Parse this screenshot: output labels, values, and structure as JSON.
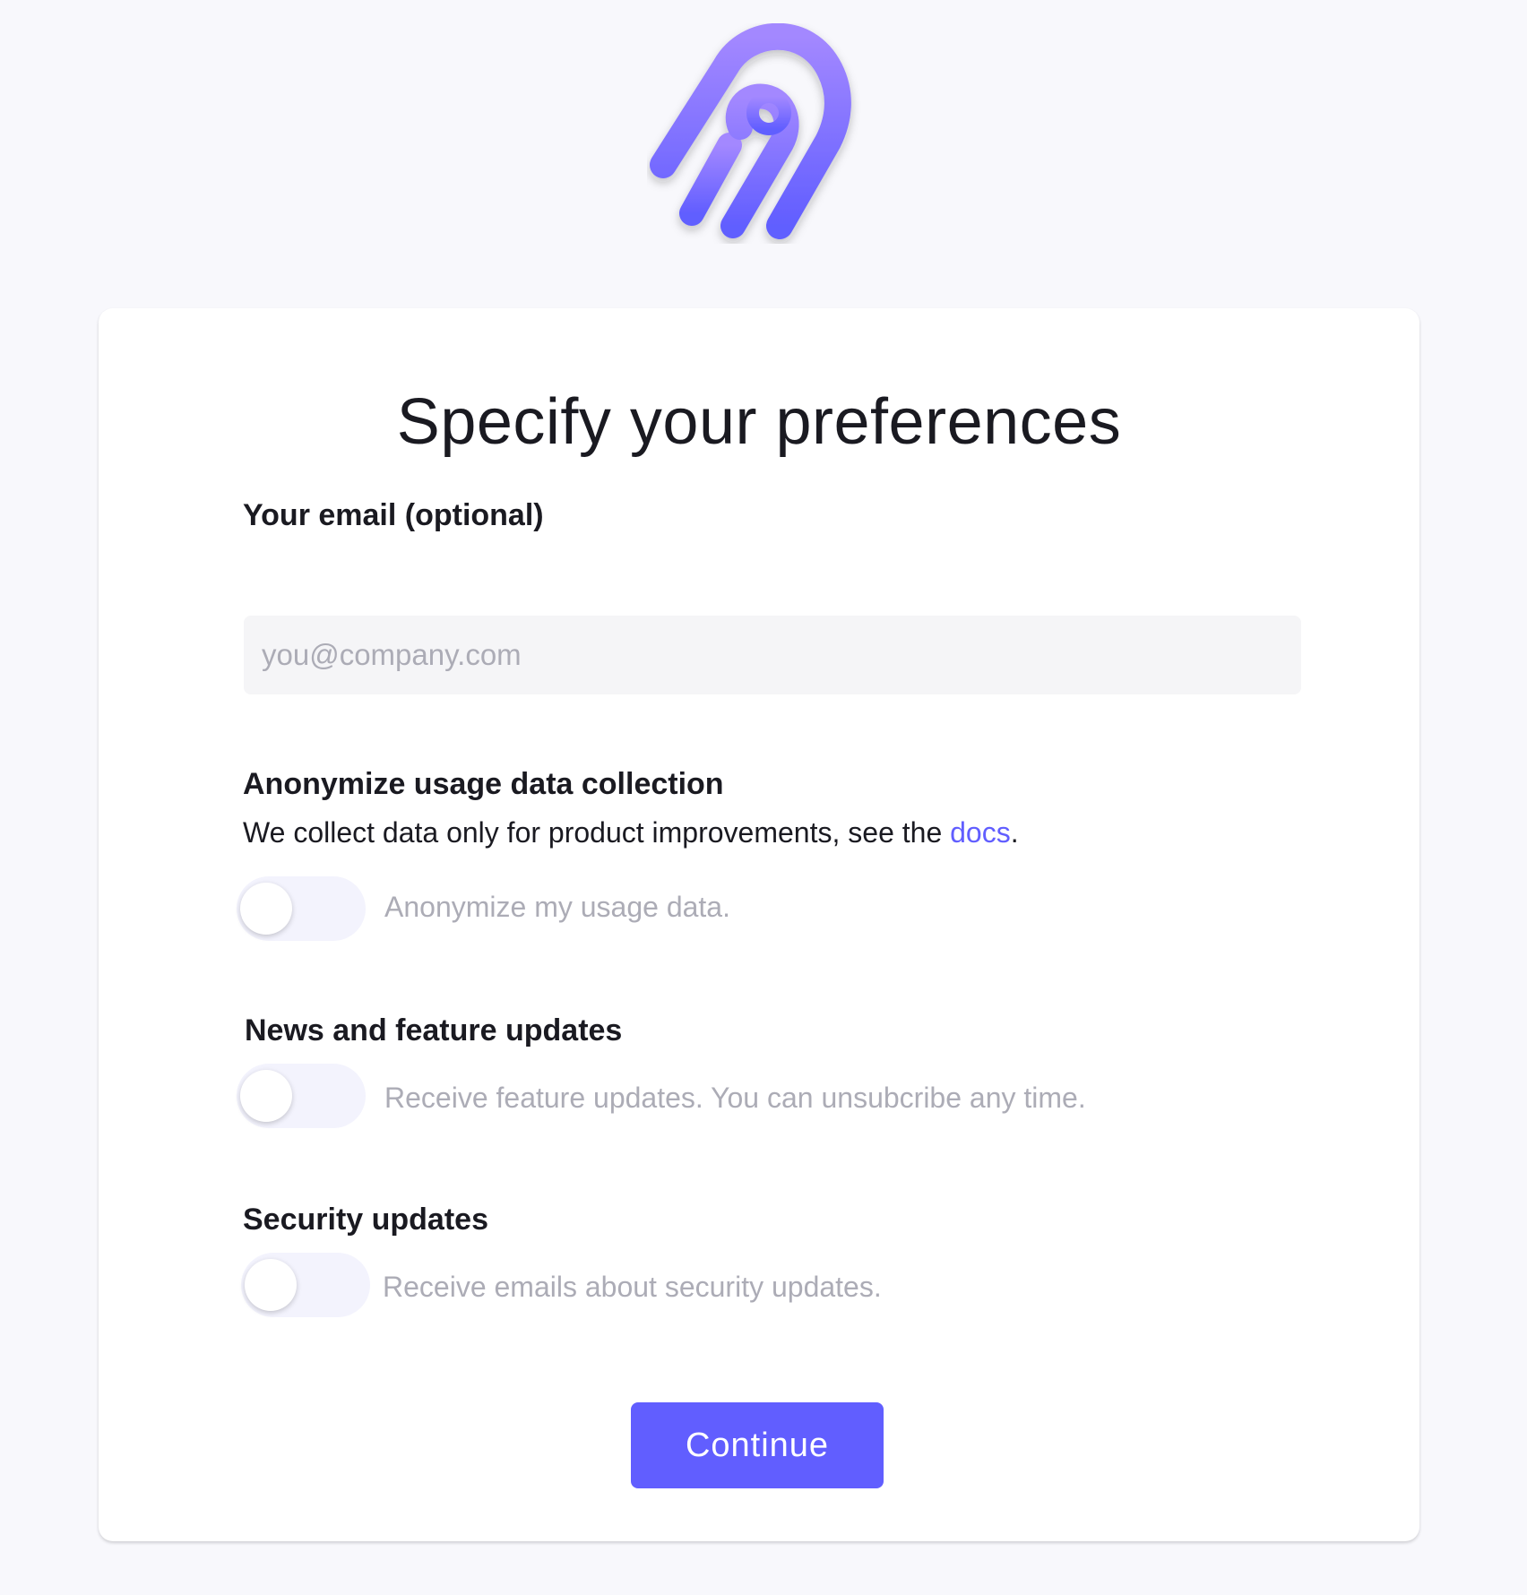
{
  "page": {
    "title": "Specify your preferences"
  },
  "email": {
    "label": "Your email (optional)",
    "placeholder": "you@company.com",
    "value": ""
  },
  "anonymize": {
    "heading": "Anonymize usage data collection",
    "description_prefix": "We collect data only for product improvements, see the ",
    "docs_link": "docs",
    "description_suffix": ".",
    "toggle_label": "Anonymize my usage data.",
    "enabled": false
  },
  "news": {
    "heading": "News and feature updates",
    "toggle_label": "Receive feature updates. You can unsubcribe any time.",
    "enabled": false
  },
  "security": {
    "heading": "Security updates",
    "toggle_label": "Receive emails about security updates.",
    "enabled": false
  },
  "actions": {
    "continue_label": "Continue"
  },
  "colors": {
    "page_background": "#f8f8fc",
    "card_background": "#ffffff",
    "primary": "#615eff",
    "text": "#1a1a21",
    "muted_text": "#acacb6",
    "input_background": "#f5f5f7",
    "toggle_track": "#f3f3fd",
    "logo_gradient_top": "#a388ff",
    "logo_gradient_bottom": "#615eff"
  },
  "icons": {
    "logo": "airbyte-logo-icon"
  }
}
